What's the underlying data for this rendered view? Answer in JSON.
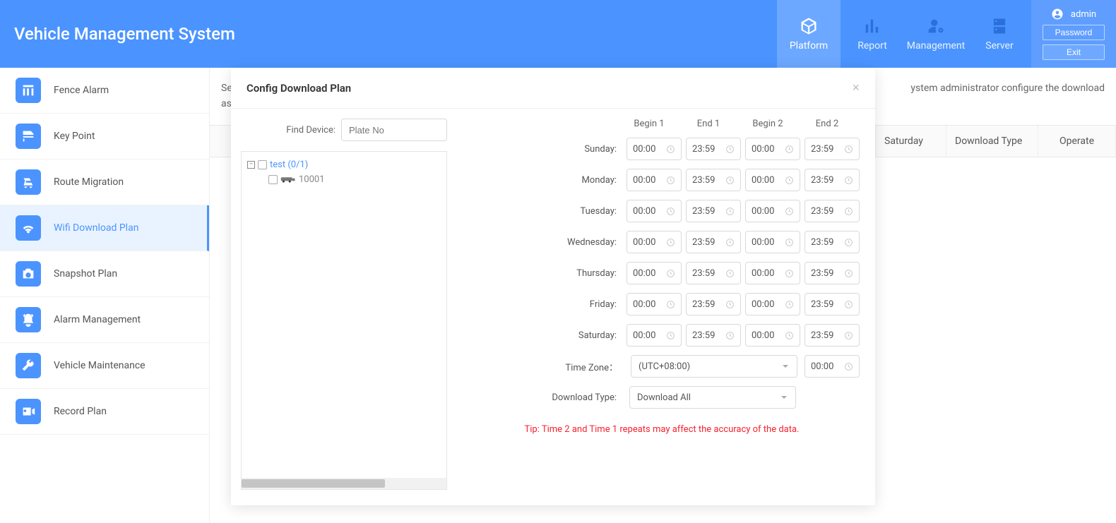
{
  "header": {
    "title": "Vehicle Management System",
    "nav": [
      {
        "key": "platform",
        "label": "Platform",
        "active": true
      },
      {
        "key": "report",
        "label": "Report",
        "active": false
      },
      {
        "key": "management",
        "label": "Management",
        "active": false
      },
      {
        "key": "server",
        "label": "Server",
        "active": false
      }
    ],
    "user": {
      "name": "admin",
      "password_btn": "Password",
      "exit_btn": "Exit"
    }
  },
  "sidebar": {
    "items": [
      {
        "key": "fence-alarm",
        "label": "Fence Alarm"
      },
      {
        "key": "key-point",
        "label": "Key Point"
      },
      {
        "key": "route-migration",
        "label": "Route Migration"
      },
      {
        "key": "wifi-download-plan",
        "label": "Wifi Download Plan"
      },
      {
        "key": "snapshot-plan",
        "label": "Snapshot Plan"
      },
      {
        "key": "alarm-management",
        "label": "Alarm Management"
      },
      {
        "key": "vehicle-maintenance",
        "label": "Vehicle Maintenance"
      },
      {
        "key": "record-plan",
        "label": "Record Plan"
      }
    ],
    "active_index": 3
  },
  "content": {
    "info_prefix": "Sel",
    "info_line2": "ass",
    "info_suffix": "ystem administrator configure the download",
    "table_cols": {
      "saturday": "Saturday",
      "download_type": "Download Type",
      "operate": "Operate"
    }
  },
  "modal": {
    "title": "Config Download Plan",
    "find_device_label": "Find Device:",
    "find_device_placeholder": "Plate No",
    "tree": {
      "group": "test (0/1)",
      "device": "10001"
    },
    "time_header": {
      "b1": "Begin 1",
      "e1": "End 1",
      "b2": "Begin 2",
      "e2": "End 2"
    },
    "days": [
      {
        "label": "Sunday:",
        "b1": "00:00",
        "e1": "23:59",
        "b2": "00:00",
        "e2": "23:59"
      },
      {
        "label": "Monday:",
        "b1": "00:00",
        "e1": "23:59",
        "b2": "00:00",
        "e2": "23:59"
      },
      {
        "label": "Tuesday:",
        "b1": "00:00",
        "e1": "23:59",
        "b2": "00:00",
        "e2": "23:59"
      },
      {
        "label": "Wednesday:",
        "b1": "00:00",
        "e1": "23:59",
        "b2": "00:00",
        "e2": "23:59"
      },
      {
        "label": "Thursday:",
        "b1": "00:00",
        "e1": "23:59",
        "b2": "00:00",
        "e2": "23:59"
      },
      {
        "label": "Friday:",
        "b1": "00:00",
        "e1": "23:59",
        "b2": "00:00",
        "e2": "23:59"
      },
      {
        "label": "Saturday:",
        "b1": "00:00",
        "e1": "23:59",
        "b2": "00:00",
        "e2": "23:59"
      }
    ],
    "timezone_label": "Time Zone：",
    "timezone_value": "(UTC+08:00)",
    "timezone_offset": "00:00",
    "download_type_label": "Download Type:",
    "download_type_value": "Download All",
    "tip": "Tip: Time 2 and Time 1 repeats may affect the accuracy of the data."
  }
}
